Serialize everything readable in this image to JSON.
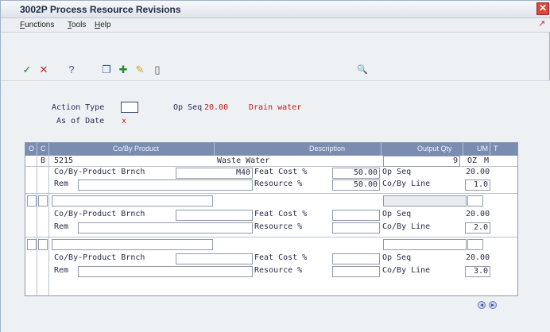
{
  "window": {
    "title": "3002P  Process Resource Revisions"
  },
  "menu": {
    "items": [
      "Functions",
      "Tools",
      "Help"
    ]
  },
  "toolbar": {
    "icons": [
      "ok-check-icon",
      "cancel-x-icon",
      "help-question-icon",
      "copy-icon",
      "add-plus-icon",
      "pencil-icon",
      "delete-trash-icon",
      "search-icon"
    ],
    "glyphs": {
      "ok": "✓",
      "cancel": "✕",
      "help": "?",
      "copy": "❐",
      "add": "✚",
      "edit": "✎",
      "delete": "▯",
      "search": "🔍"
    }
  },
  "header_form": {
    "action_type_label": "Action Type",
    "action_type_value": "",
    "op_seq_label": "Op Seq",
    "op_seq_value": "20.00",
    "op_seq_desc": "Drain water",
    "as_of_date_label": "As of Date",
    "as_of_date_marker": "x"
  },
  "grid": {
    "columns": [
      "O",
      "C",
      "Co/By Product",
      "Description",
      "Output Qty",
      "UM",
      "T"
    ],
    "labels": {
      "branch": "Co/By-Product Brnch",
      "rem": "Rem",
      "feat_cost": "Feat Cost %",
      "resource": "Resource %",
      "op_seq": "Op Seq",
      "co_by_line": "Co/By Line"
    },
    "rows": [
      {
        "c": "B",
        "product": "5215",
        "description": "Waste Water",
        "output_qty": "9",
        "um": "OZ",
        "t": "M",
        "branch": "M40",
        "feat_cost": "50.00",
        "resource": "50.00",
        "op_seq": "20.00",
        "co_by_line": "1.0"
      },
      {
        "c": "",
        "product": "",
        "description": "",
        "output_qty": "",
        "um": "",
        "t": "",
        "branch": "",
        "feat_cost": "",
        "resource": "",
        "op_seq": "20.00",
        "co_by_line": "2.0"
      },
      {
        "c": "",
        "product": "",
        "description": "",
        "output_qty": "",
        "um": "",
        "t": "",
        "branch": "",
        "feat_cost": "",
        "resource": "",
        "op_seq": "20.00",
        "co_by_line": "3.0"
      }
    ]
  },
  "nav": {
    "prev": "◀",
    "next": "▶"
  },
  "colors": {
    "title_accent": "#1f2a44",
    "grid_header": "#7a8db0",
    "value_red": "#c01a1a"
  }
}
